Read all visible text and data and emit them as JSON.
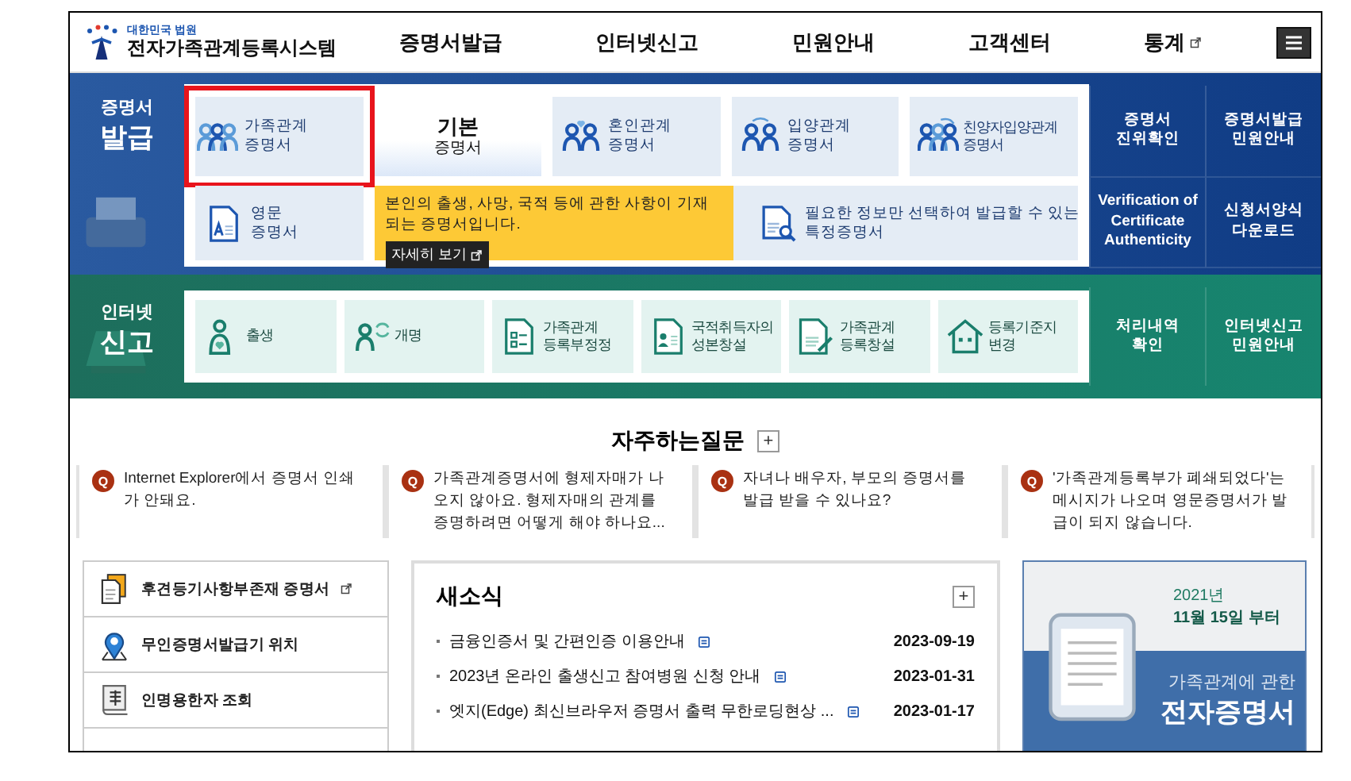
{
  "header": {
    "logo": {
      "org": "대한민국 법원",
      "title": "전자가족관계등록시스템"
    },
    "nav": [
      {
        "label": "증명서발급",
        "external": false
      },
      {
        "label": "인터넷신고",
        "external": false
      },
      {
        "label": "민원안내",
        "external": false
      },
      {
        "label": "고객센터",
        "external": false
      },
      {
        "label": "통계",
        "external": true
      }
    ]
  },
  "certificates": {
    "label": [
      "증명서",
      "발급"
    ],
    "items": [
      {
        "label": "가족관계\n증명서",
        "kind": "family",
        "selected": false,
        "highlighted": true
      },
      {
        "label": "기본\n증명서",
        "kind": "tab",
        "selected": true,
        "highlighted": false
      },
      {
        "label": "혼인관계\n증명서",
        "kind": "marriage",
        "selected": false,
        "highlighted": false
      },
      {
        "label": "입양관계\n증명서",
        "kind": "adoption",
        "selected": false,
        "highlighted": false
      },
      {
        "label": "친양자입양관계\n증명서",
        "kind": "full-adoption",
        "selected": false,
        "highlighted": false
      },
      {
        "label": "영문\n증명서",
        "kind": "english",
        "selected": false,
        "highlighted": false
      },
      {
        "label": "필요한 정보만 선택하여 발급할 수 있는\n특정증명서",
        "kind": "specific",
        "selected": false,
        "highlighted": false
      }
    ],
    "tooltip": {
      "text": "본인의 출생, 사망, 국적 등에 관한 사항이 기재되는 증명서입니다.",
      "button": "자세히 보기"
    },
    "side_links": [
      "증명서\n진위확인",
      "증명서발급\n민원안내",
      "Verification of\nCertificate\nAuthenticity",
      "신청서양식\n다운로드"
    ]
  },
  "reports": {
    "label": [
      "인터넷",
      "신고"
    ],
    "items": [
      {
        "label": "출생",
        "kind": "birth"
      },
      {
        "label": "개명",
        "kind": "rename"
      },
      {
        "label": "가족관계\n등록부정정",
        "kind": "doc-list"
      },
      {
        "label": "국적취득자의\n성본창설",
        "kind": "doc-person"
      },
      {
        "label": "가족관계\n등록창설",
        "kind": "doc-pen"
      },
      {
        "label": "등록기준지\n변경",
        "kind": "house"
      }
    ],
    "side_links": [
      "처리내역\n확인",
      "인터넷신고\n민원안내"
    ]
  },
  "faq": {
    "title": "자주하는질문",
    "more": "+",
    "items": [
      {
        "marker": "Q",
        "text": "Internet Explorer에서 증명서 인쇄가 안돼요."
      },
      {
        "marker": "Q",
        "text": "가족관계증명서에 형제자매가 나오지 않아요. 형제자매의 관계를 증명하려면 어떻게 해야 하나요..."
      },
      {
        "marker": "Q",
        "text": "자녀나 배우자, 부모의 증명서를 발급 받을 수 있나요?"
      },
      {
        "marker": "Q",
        "text": "'가족관계등록부가 폐쇄되었다'는 메시지가 나오며 영문증명서가 발급이 되지 않습니다."
      }
    ]
  },
  "quick_links": [
    {
      "label": "후견등기사항부존재 증명서",
      "kind": "document",
      "external": true
    },
    {
      "label": "무인증명서발급기 위치",
      "kind": "location",
      "external": false
    },
    {
      "label": "인명용한자 조회",
      "kind": "book",
      "external": false
    }
  ],
  "news": {
    "title": "새소식",
    "more": "+",
    "items": [
      {
        "title": "금융인증서 및 간편인증 이용안내",
        "date": "2023-09-19",
        "attachment": true
      },
      {
        "title": "2023년 온라인 출생신고 참여병원 신청 안내",
        "date": "2023-01-31",
        "attachment": true
      },
      {
        "title": "엣지(Edge) 최신브라우저 증명서 출력 무한로딩현상 ...",
        "date": "2023-01-17",
        "attachment": true
      }
    ]
  },
  "banner": {
    "year": "2021년",
    "date": "11월 15일 부터",
    "subtitle": "가족관계에 관한",
    "title": "전자증명서"
  }
}
